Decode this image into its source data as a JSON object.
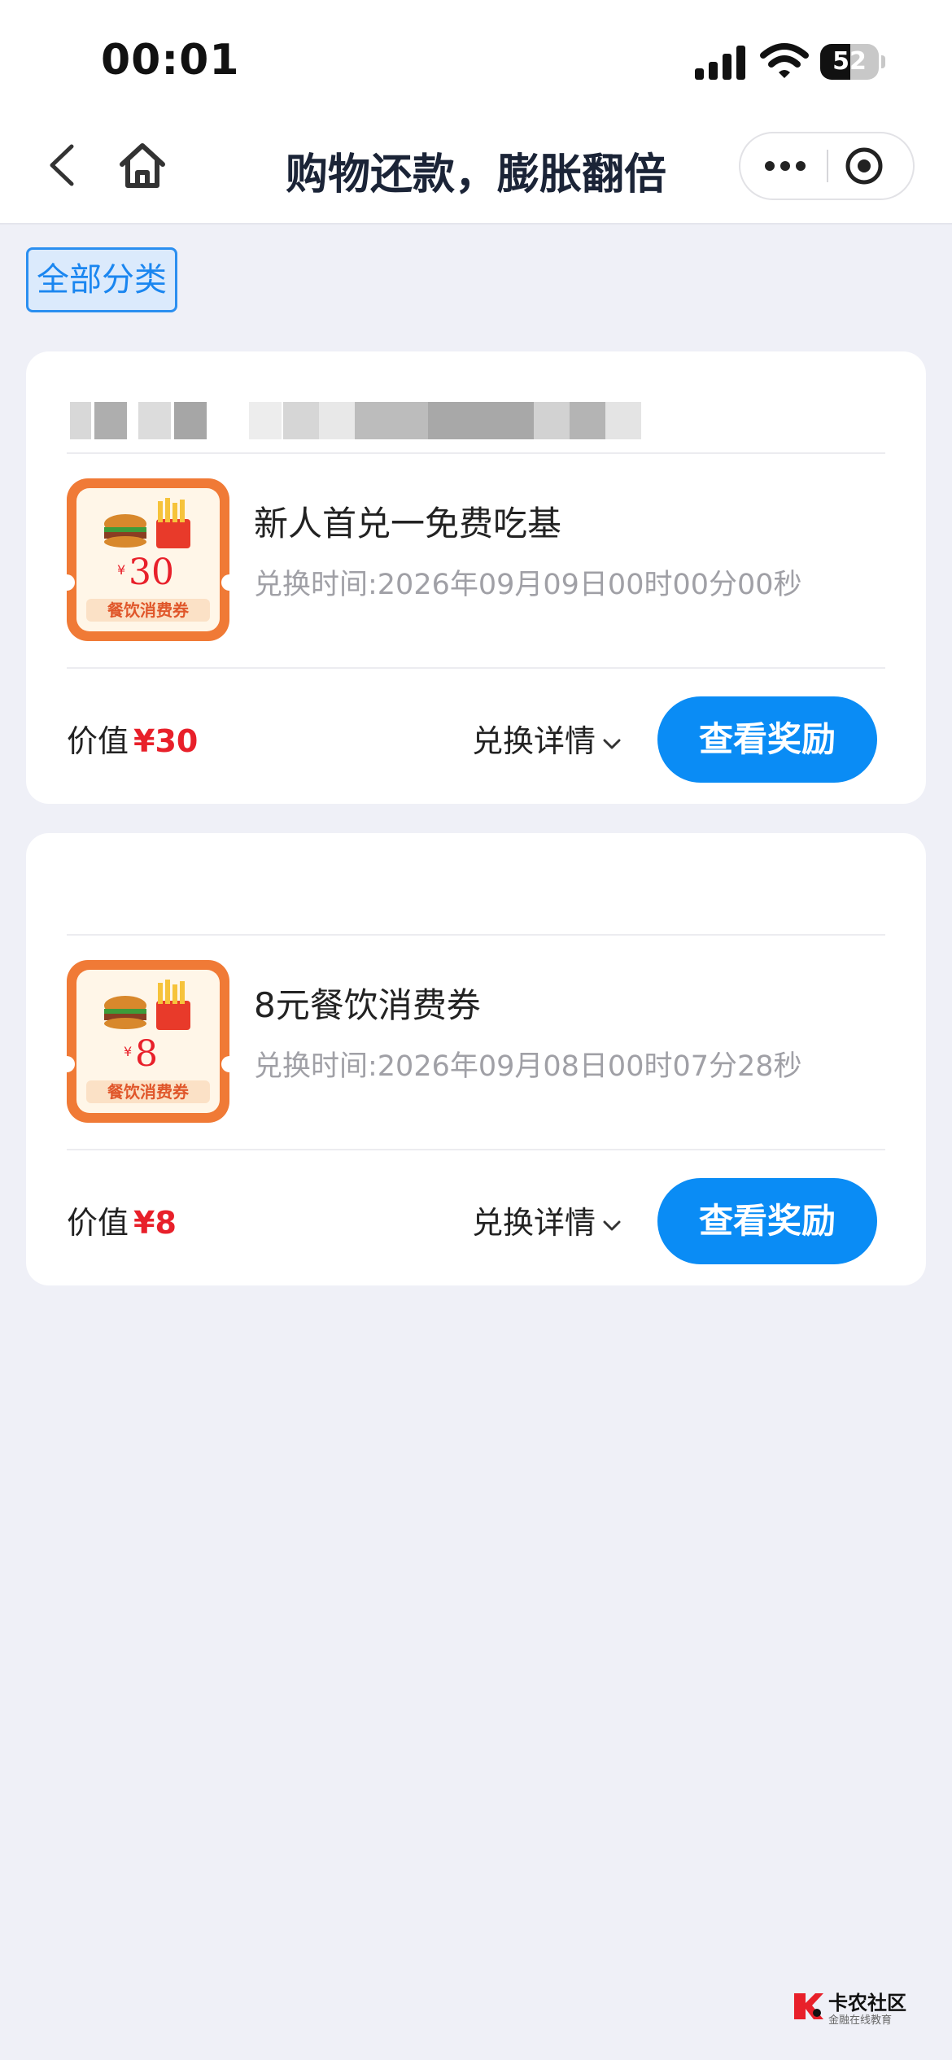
{
  "status_bar": {
    "time": "00:01",
    "battery_level": "52"
  },
  "nav": {
    "title": "购物还款，膨胀翻倍"
  },
  "filter": {
    "category_label": "全部分类"
  },
  "coupons": [
    {
      "badge_amount": "30",
      "badge_currency": "¥",
      "badge_caption": "餐饮消费券",
      "title": "新人首兑一免费吃基",
      "time": "兑换时间:2026年09月09日00时00分00秒",
      "value_label": "价值",
      "value_amount": "¥30",
      "detail_label": "兑换详情",
      "button_label": "查看奖励"
    },
    {
      "badge_amount": "8",
      "badge_currency": "¥",
      "badge_caption": "餐饮消费券",
      "title": "8元餐饮消费券",
      "time": "兑换时间:2026年09月08日00时07分28秒",
      "value_label": "价值",
      "value_amount": "¥8",
      "detail_label": "兑换详情",
      "button_label": "查看奖励"
    }
  ],
  "watermark": {
    "title": "卡农社区",
    "subtitle": "金融在线教育"
  },
  "colors": {
    "accent": "#0a8cf5",
    "price": "#e8202a",
    "background": "#eff0f7"
  }
}
